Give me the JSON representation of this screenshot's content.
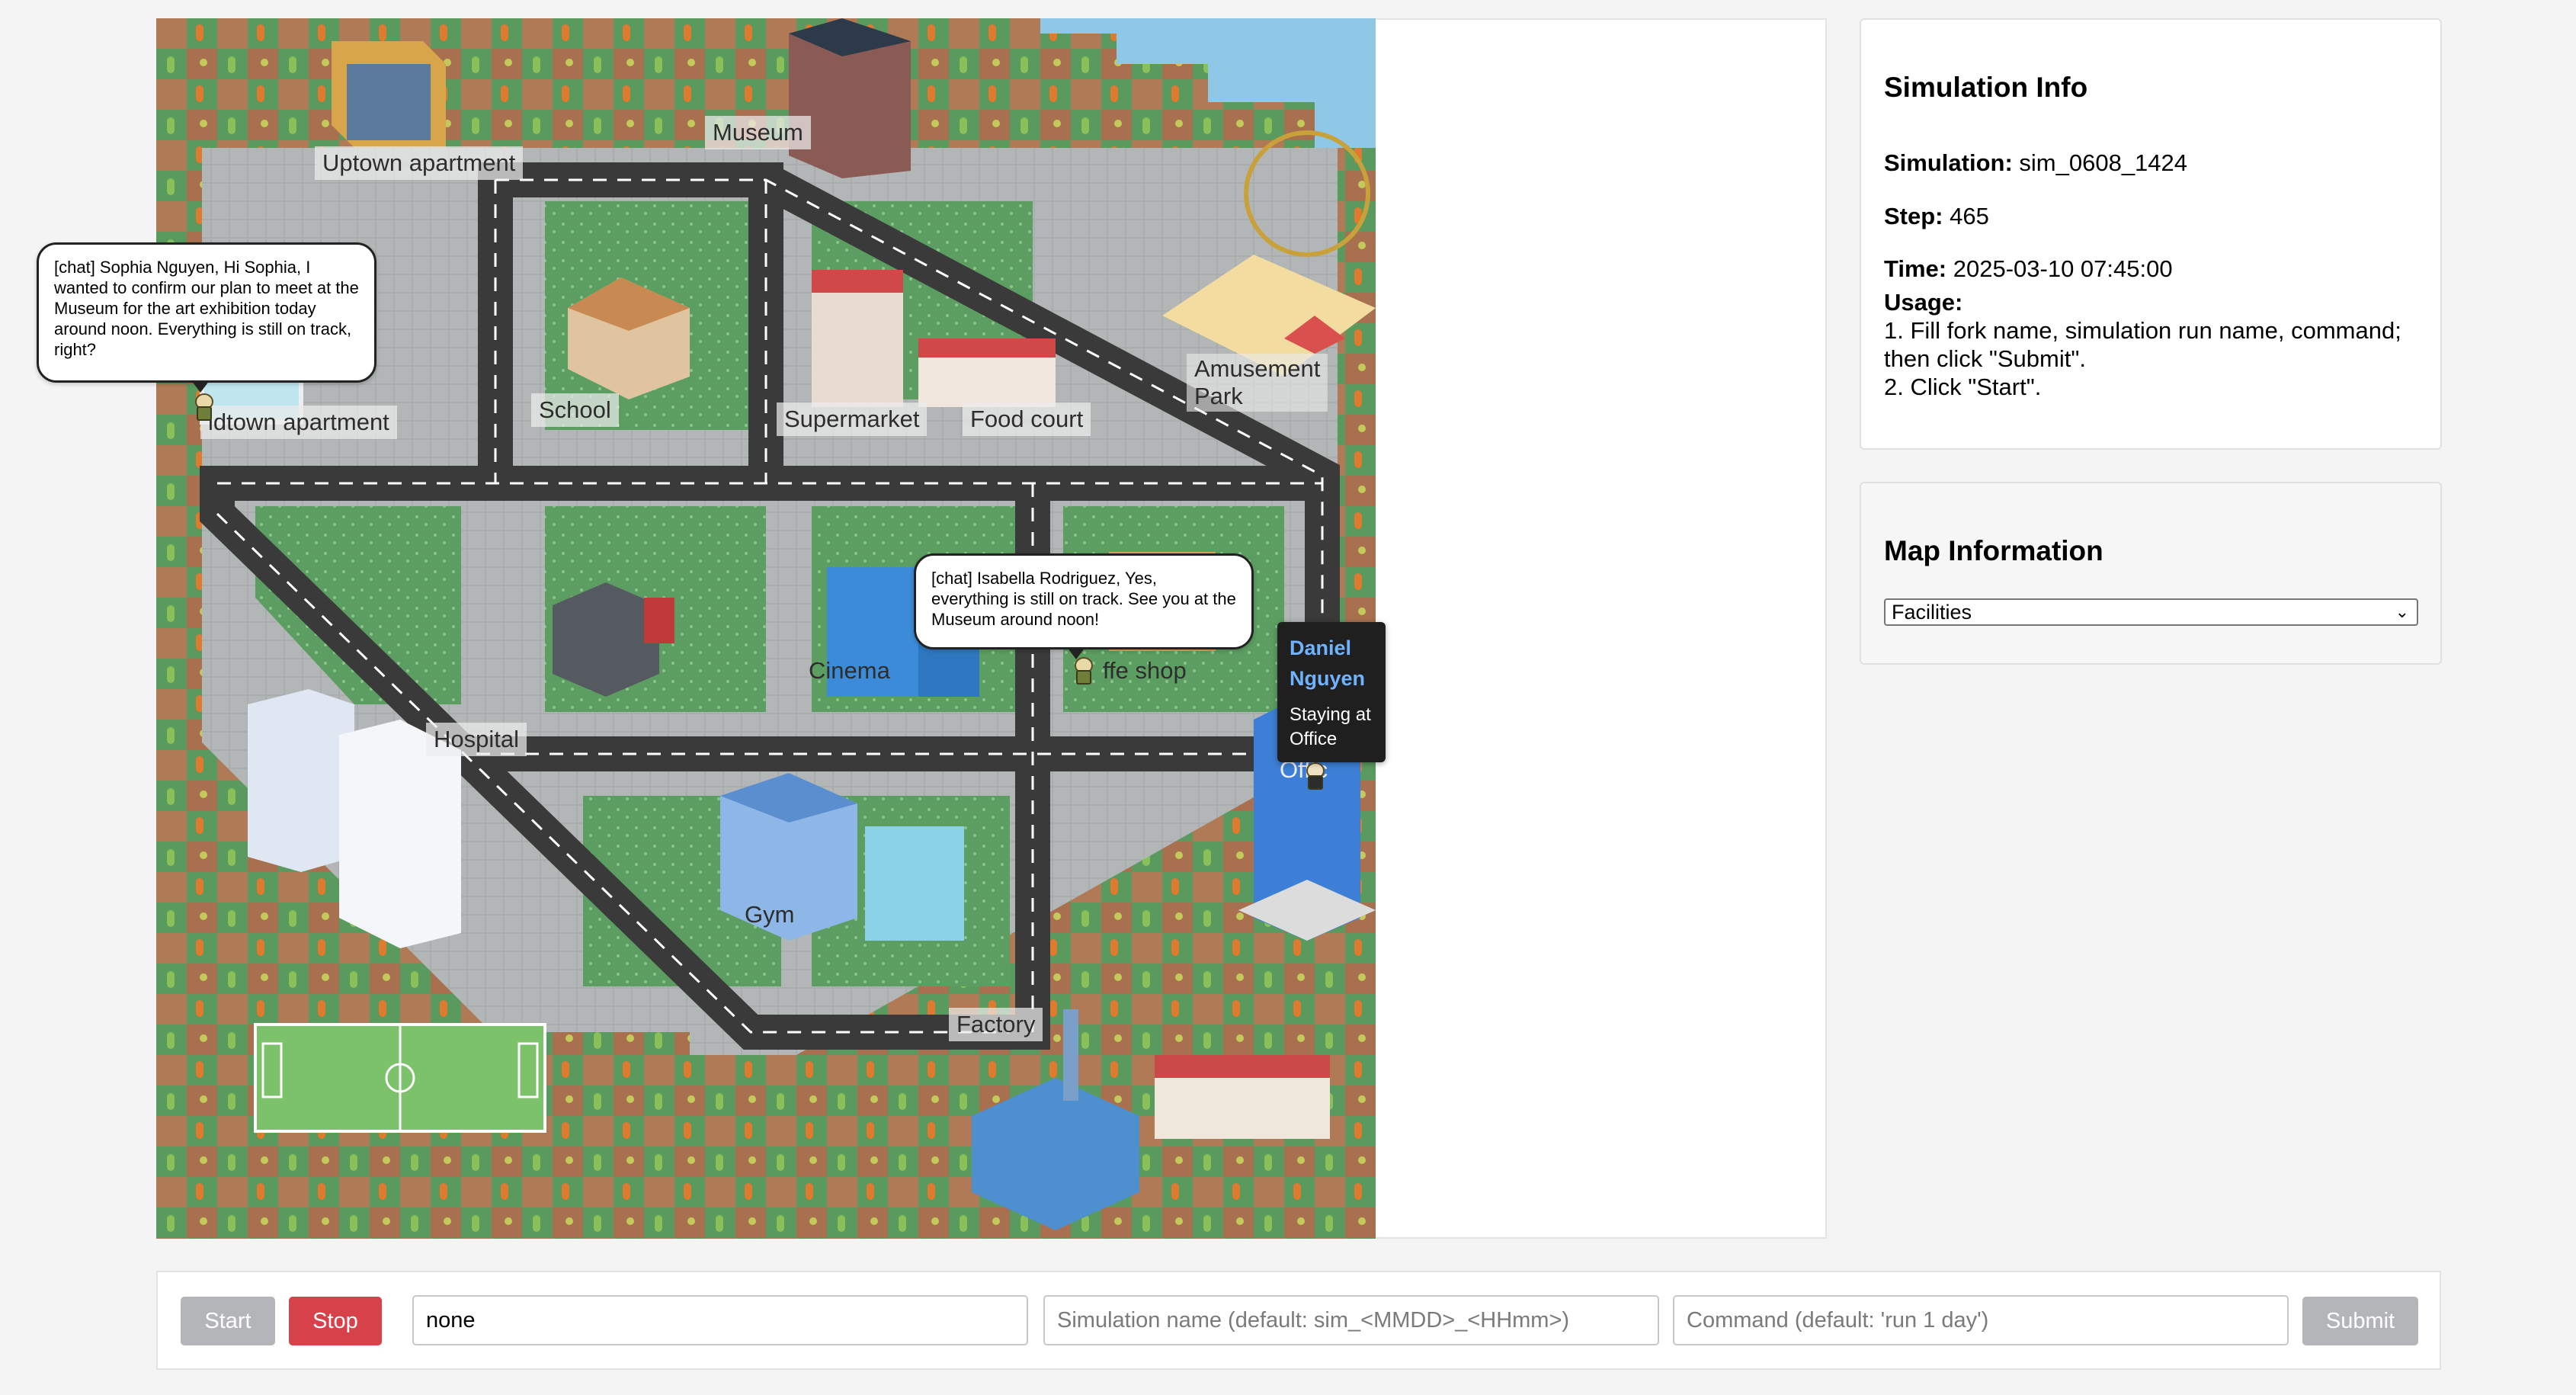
{
  "map": {
    "locations": {
      "uptown": "Uptown apartment",
      "museum": "Museum",
      "midtown": "idtown apartment",
      "school": "School",
      "supermarket": "Supermarket",
      "foodcourt": "Food court",
      "amusement1": "Amusement",
      "amusement2": "Park",
      "cinema": "Cinema",
      "coffee": "ffe shop",
      "hospital": "Hospital",
      "office": "Offic",
      "gym": "Gym",
      "factory": "Factory"
    },
    "chats": {
      "sophia": "[chat] Sophia Nguyen, Hi Sophia, I wanted to confirm our plan to meet at the Museum for the art exhibition today around noon. Everything is still on track, right?",
      "isabella": "[chat] Isabella Rodriguez, Yes, everything is still on track. See you at the Museum around noon!"
    },
    "tooltip": {
      "name": "Daniel Nguyen",
      "status": "Staying at Office"
    }
  },
  "sim_info": {
    "title": "Simulation Info",
    "simulation_label": "Simulation:",
    "simulation_value": "sim_0608_1424",
    "step_label": "Step:",
    "step_value": "465",
    "time_label": "Time:",
    "time_value": "2025-03-10 07:45:00",
    "usage_label": "Usage:",
    "usage_line1": "1. Fill fork name, simulation run name, command; then click \"Submit\".",
    "usage_line2": "2. Click \"Start\"."
  },
  "map_info": {
    "title": "Map Information",
    "selected": "Facilities"
  },
  "controls": {
    "start": "Start",
    "stop": "Stop",
    "fork_value": "none",
    "sim_name_placeholder": "Simulation name (default: sim_<MMDD>_<HHmm>)",
    "command_placeholder": "Command (default: 'run 1 day')",
    "submit": "Submit"
  },
  "colors": {
    "grass": "#5a9a5f",
    "dirt": "#b07a56",
    "road": "#3a3a3a",
    "sidewalk": "#a9adad",
    "stop_button": "#d7414a",
    "disabled_button": "#b3b5b8",
    "tooltip_name": "#6fb3ff"
  }
}
